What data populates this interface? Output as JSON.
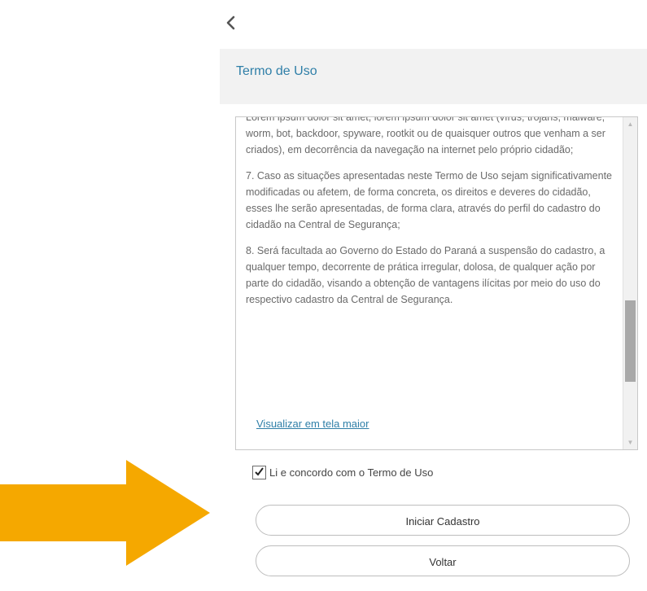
{
  "nav": {
    "back_icon": "chevron-left-icon"
  },
  "header": {
    "title": "Termo de Uso"
  },
  "terms": {
    "paragraphs": [
      "Lorem ipsum dolor sit amet, lorem ipsum dolor sit amet (vírus, trojans, malware, worm, bot, backdoor, spyware, rootkit ou de quaisquer outros que venham a ser criados), em decorrência da navegação na internet pelo próprio cidadão;",
      "7. Caso as situações apresentadas neste Termo de Uso sejam significativamente modificadas ou afetem, de forma concreta, os direitos e deveres do cidadão, esses lhe serão apresentadas, de forma clara, através do perfil do cadastro do cidadão na Central de Segurança;",
      "8. Será facultada ao Governo do Estado do Paraná a suspensão do cadastro, a qualquer tempo, decorrente de prática irregular, dolosa, de qualquer ação por parte do cidadão, visando a obtenção de vantagens ilícitas por meio do uso do respectivo cadastro da Central de Segurança."
    ],
    "scroll_up_icon": "triangle-up-icon",
    "scroll_down_icon": "triangle-down-icon",
    "scroll_position": 0.62
  },
  "links": {
    "view_larger": "Visualizar em tela maior"
  },
  "agreement": {
    "label": "Li e concordo com o Termo de Uso",
    "checked": true
  },
  "buttons": {
    "start": "Iniciar Cadastro",
    "back": "Voltar"
  },
  "annotation": {
    "arrow_color": "#f5a800"
  }
}
